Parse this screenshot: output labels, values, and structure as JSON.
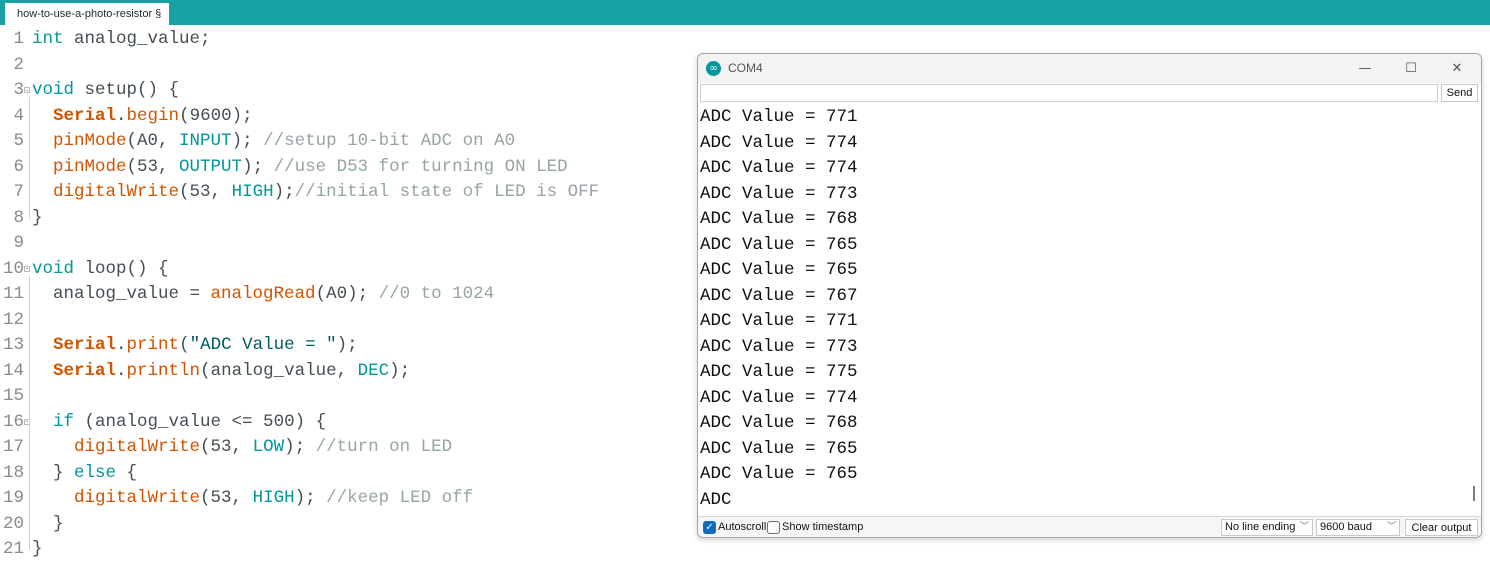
{
  "editor": {
    "tab_label": "how-to-use-a-photo-resistor §",
    "lines": [
      {
        "n": "1",
        "code": [
          [
            "kw",
            "int"
          ],
          [
            "pl",
            " analog_value;"
          ]
        ]
      },
      {
        "n": "2",
        "code": []
      },
      {
        "n": "3",
        "code": [
          [
            "kw",
            "void"
          ],
          [
            "pl",
            " setup() {"
          ]
        ]
      },
      {
        "n": "4",
        "code": [
          [
            "pl",
            "  "
          ],
          [
            "ser",
            "Serial"
          ],
          [
            "pl",
            "."
          ],
          [
            "fn",
            "begin"
          ],
          [
            "pl",
            "(9600);"
          ]
        ]
      },
      {
        "n": "5",
        "code": [
          [
            "pl",
            "  "
          ],
          [
            "fn",
            "pinMode"
          ],
          [
            "pl",
            "(A0, "
          ],
          [
            "cst",
            "INPUT"
          ],
          [
            "pl",
            "); "
          ],
          [
            "cmt",
            "//setup 10-bit ADC on A0"
          ]
        ]
      },
      {
        "n": "6",
        "code": [
          [
            "pl",
            "  "
          ],
          [
            "fn",
            "pinMode"
          ],
          [
            "pl",
            "(53, "
          ],
          [
            "cst",
            "OUTPUT"
          ],
          [
            "pl",
            "); "
          ],
          [
            "cmt",
            "//use D53 for turning ON LED"
          ]
        ]
      },
      {
        "n": "7",
        "code": [
          [
            "pl",
            "  "
          ],
          [
            "fn",
            "digitalWrite"
          ],
          [
            "pl",
            "(53, "
          ],
          [
            "cst",
            "HIGH"
          ],
          [
            "pl",
            ");"
          ],
          [
            "cmt",
            "//initial state of LED is OFF"
          ]
        ]
      },
      {
        "n": "8",
        "code": [
          [
            "pl",
            "}"
          ]
        ]
      },
      {
        "n": "9",
        "code": []
      },
      {
        "n": "10",
        "code": [
          [
            "kw",
            "void"
          ],
          [
            "pl",
            " loop() {"
          ]
        ]
      },
      {
        "n": "11",
        "code": [
          [
            "pl",
            "  analog_value = "
          ],
          [
            "fn",
            "analogRead"
          ],
          [
            "pl",
            "(A0); "
          ],
          [
            "cmt",
            "//0 to 1024"
          ]
        ]
      },
      {
        "n": "12",
        "code": []
      },
      {
        "n": "13",
        "code": [
          [
            "pl",
            "  "
          ],
          [
            "ser",
            "Serial"
          ],
          [
            "pl",
            "."
          ],
          [
            "fn",
            "print"
          ],
          [
            "pl",
            "("
          ],
          [
            "str",
            "\"ADC Value = \""
          ],
          [
            "pl",
            ");"
          ]
        ]
      },
      {
        "n": "14",
        "code": [
          [
            "pl",
            "  "
          ],
          [
            "ser",
            "Serial"
          ],
          [
            "pl",
            "."
          ],
          [
            "fn",
            "println"
          ],
          [
            "pl",
            "(analog_value, "
          ],
          [
            "cst",
            "DEC"
          ],
          [
            "pl",
            ");"
          ]
        ]
      },
      {
        "n": "15",
        "code": []
      },
      {
        "n": "16",
        "code": [
          [
            "pl",
            "  "
          ],
          [
            "kw",
            "if"
          ],
          [
            "pl",
            " (analog_value <= 500) {"
          ]
        ]
      },
      {
        "n": "17",
        "code": [
          [
            "pl",
            "    "
          ],
          [
            "fn",
            "digitalWrite"
          ],
          [
            "pl",
            "(53, "
          ],
          [
            "cst",
            "LOW"
          ],
          [
            "pl",
            "); "
          ],
          [
            "cmt",
            "//turn on LED"
          ]
        ]
      },
      {
        "n": "18",
        "code": [
          [
            "pl",
            "  } "
          ],
          [
            "kw",
            "else"
          ],
          [
            "pl",
            " {"
          ]
        ]
      },
      {
        "n": "19",
        "code": [
          [
            "pl",
            "    "
          ],
          [
            "fn",
            "digitalWrite"
          ],
          [
            "pl",
            "(53, "
          ],
          [
            "cst",
            "HIGH"
          ],
          [
            "pl",
            "); "
          ],
          [
            "cmt",
            "//keep LED off"
          ]
        ]
      },
      {
        "n": "20",
        "code": [
          [
            "pl",
            "  }"
          ]
        ]
      },
      {
        "n": "21",
        "code": [
          [
            "pl",
            "}"
          ]
        ]
      }
    ]
  },
  "serial_monitor": {
    "title": "COM4",
    "app_icon": "∞",
    "controls": {
      "minimize": "—",
      "maximize": "☐",
      "close": "✕"
    },
    "input_value": "",
    "send_label": "Send",
    "output_lines": [
      "ADC Value = 771",
      "ADC Value = 774",
      "ADC Value = 774",
      "ADC Value = 773",
      "ADC Value = 768",
      "ADC Value = 765",
      "ADC Value = 765",
      "ADC Value = 767",
      "ADC Value = 771",
      "ADC Value = 773",
      "ADC Value = 775",
      "ADC Value = 774",
      "ADC Value = 768",
      "ADC Value = 765",
      "ADC Value = 765",
      "ADC"
    ],
    "autoscroll_label": "Autoscroll",
    "autoscroll_checked": true,
    "timestamp_label": "Show timestamp",
    "timestamp_checked": false,
    "line_ending": "No line ending",
    "baud_rate": "9600 baud",
    "clear_label": "Clear output"
  },
  "colors": {
    "tab_bar": "#17a1a5",
    "keyword": "#00979c",
    "function": "#d35400",
    "comment": "#95a5a6",
    "checkbox_accent": "#0f6cbd"
  }
}
